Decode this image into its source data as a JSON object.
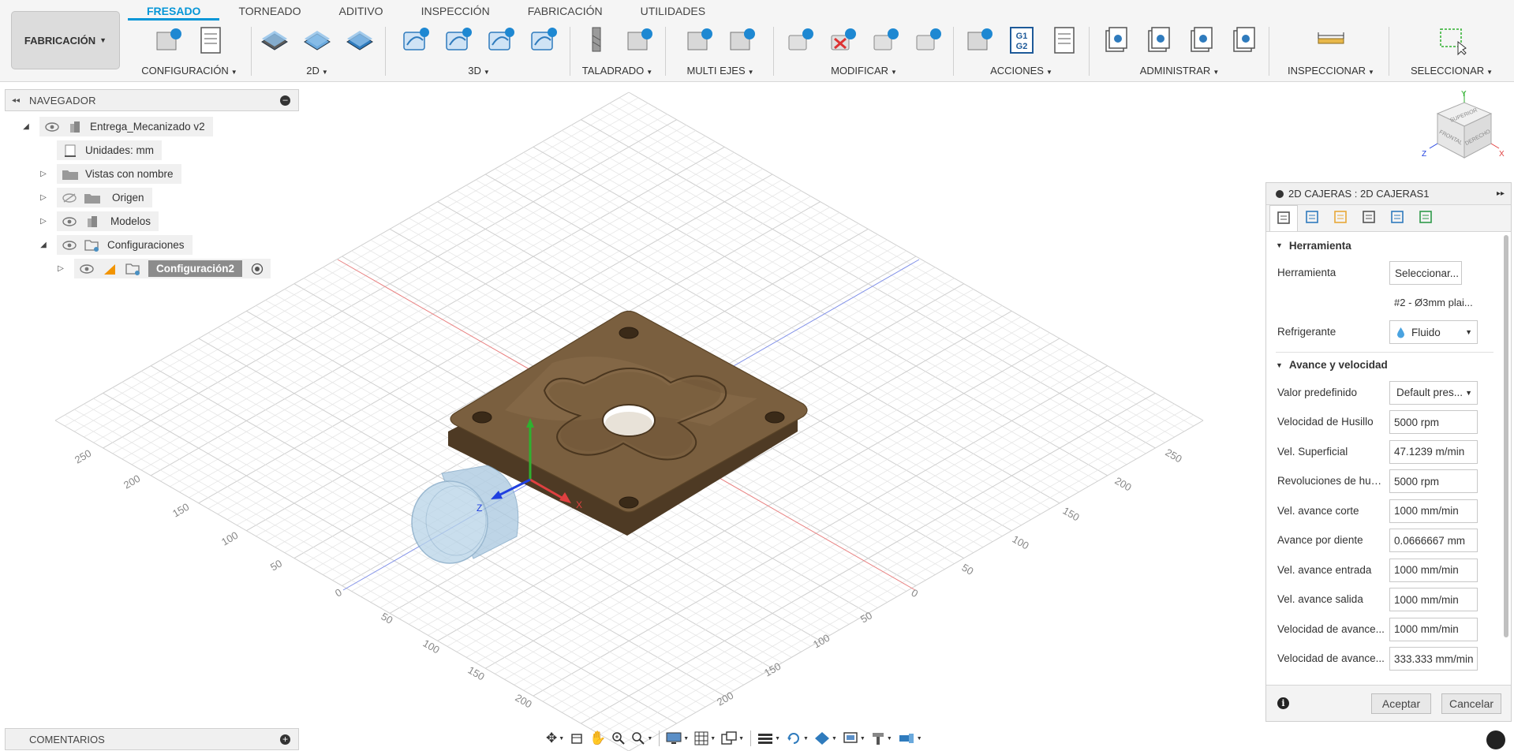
{
  "workspace": {
    "label": "FABRICACIÓN"
  },
  "tabs": [
    {
      "label": "FRESADO",
      "active": true
    },
    {
      "label": "TORNEADO"
    },
    {
      "label": "ADITIVO"
    },
    {
      "label": "INSPECCIÓN"
    },
    {
      "label": "FABRICACIÓN"
    },
    {
      "label": "UTILIDADES"
    }
  ],
  "toolbar_groups": [
    {
      "label": "CONFIGURACIÓN",
      "icons": [
        "new-setup-icon",
        "nc-program-icon"
      ]
    },
    {
      "label": "2D",
      "icons": [
        "2d-adaptive-icon",
        "2d-pocket-icon",
        "face-icon"
      ]
    },
    {
      "label": "3D",
      "icons": [
        "3d-adaptive-icon",
        "3d-pocket-icon",
        "3d-steep-icon",
        "3d-flow-icon"
      ]
    },
    {
      "label": "TALADRADO",
      "icons": [
        "drill-icon",
        "hole-recognition-icon"
      ]
    },
    {
      "label": "MULTI EJES",
      "icons": [
        "multi-axis-swarf-icon",
        "multi-axis-rotary-icon"
      ]
    },
    {
      "label": "MODIFICAR",
      "icons": [
        "cut-icon",
        "delete-icon",
        "transform-icon",
        "pattern-icon"
      ]
    },
    {
      "label": "ACCIONES",
      "icons": [
        "simulate-icon",
        "post-process-icon",
        "setup-sheet-icon"
      ]
    },
    {
      "label": "ADMINISTRAR",
      "icons": [
        "tool-library-icon",
        "machine-library-icon",
        "post-library-icon",
        "template-library-icon"
      ]
    },
    {
      "label": "INSPECCIONAR",
      "icons": [
        "measure-icon"
      ]
    },
    {
      "label": "SELECCIONAR",
      "icons": [
        "window-select-icon"
      ]
    }
  ],
  "browser": {
    "title": "NAVEGADOR",
    "root": "Entrega_Mecanizado v2",
    "units": "Unidades: mm",
    "named_views": "Vistas con nombre",
    "origin": "Origen",
    "models": "Modelos",
    "setups": "Configuraciones",
    "setup2": "Configuración2"
  },
  "comments": {
    "title": "COMENTARIOS"
  },
  "viewcube": {
    "top": "SUPERIOR",
    "front": "FRONTAL",
    "right": "DERECHO",
    "axis_x": "X",
    "axis_y": "Y",
    "axis_z": "Z"
  },
  "grid_labels": {
    "left_axis": [
      "250",
      "200",
      "150",
      "100",
      "50",
      "0"
    ],
    "bottom_left": [
      "50",
      "100",
      "150",
      "200"
    ],
    "right_top": [
      "250",
      "200",
      "150",
      "100",
      "50",
      "0"
    ],
    "bottom_right": [
      "50",
      "100",
      "150",
      "200"
    ]
  },
  "triad": {
    "z": "Z",
    "x": "X"
  },
  "operation": {
    "title": "2D CAJERAS : 2D CAJERAS1",
    "tabs": [
      "tool-tab-icon",
      "geometry-tab-icon",
      "heights-tab-icon",
      "passes-tab-icon",
      "linking-tab-icon",
      "simulation-tab-icon"
    ],
    "section_tool": "Herramienta",
    "tool_label": "Herramienta",
    "tool_button": "Seleccionar...",
    "tool_name": "#2 - Ø3mm plai...",
    "coolant_label": "Refrigerante",
    "coolant_value": "Fluido",
    "section_feed": "Avance y velocidad",
    "preset_label": "Valor predefinido",
    "preset_value": "Default pres...",
    "fields": [
      {
        "label": "Velocidad de Husillo",
        "value": "5000 rpm"
      },
      {
        "label": "Vel. Superficial",
        "value": "47.1239 m/min"
      },
      {
        "label": "Revoluciones de hus...",
        "value": "5000 rpm"
      },
      {
        "label": "Vel. avance corte",
        "value": "1000 mm/min"
      },
      {
        "label": "Avance por diente",
        "value": "0.0666667 mm"
      },
      {
        "label": "Vel. avance entrada",
        "value": "1000 mm/min"
      },
      {
        "label": "Vel. avance salida",
        "value": "1000 mm/min"
      },
      {
        "label": "Velocidad de avance...",
        "value": "1000 mm/min"
      },
      {
        "label": "Velocidad de avance...",
        "value": "333.333 mm/min"
      }
    ],
    "accept": "Aceptar",
    "cancel": "Cancelar"
  },
  "colors": {
    "accent": "#0696d7",
    "wood": "#7a5f3f",
    "wood_edge": "#4e3a24",
    "x_axis": "#e04040",
    "y_axis": "#2fb02f",
    "z_axis": "#2040e0"
  }
}
